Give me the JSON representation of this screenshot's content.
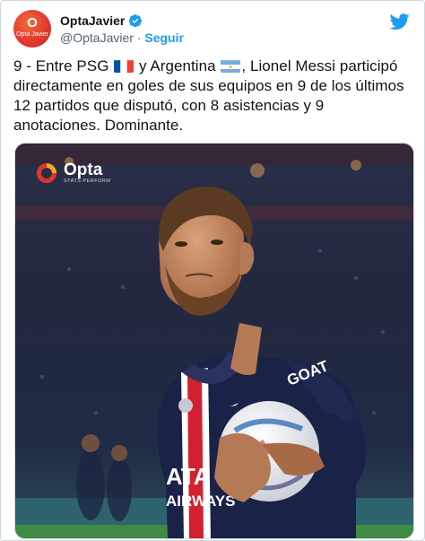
{
  "author": {
    "display_name": "OptaJavier",
    "handle": "@OptaJavier",
    "separator": "·",
    "follow_label": "Seguir",
    "avatar_letter": "O",
    "avatar_caption": "Opta Javier",
    "verified": true
  },
  "tweet": {
    "part1": "9 - Entre PSG",
    "part2": " y Argentina",
    "part3": ", Lionel Messi participó directamente en goles de sus equipos en 9 de los últimos 12 partidos que disputó, con 8 asistencias y 9 anotaciones. Dominante.",
    "flag1": "france-flag",
    "flag2": "argentina-flag"
  },
  "media": {
    "logo_word": "Opta",
    "logo_sub": "STATS PERFORM",
    "shirt_text_1": "ATA",
    "shirt_text_2": "AIRWAYS",
    "sleeve_text": "GOAT",
    "colors": {
      "shirt": "#1b2247",
      "red_stripe": "#d22030",
      "pitch": "#3f8a44",
      "brand_red": "#e1362d",
      "twitter_blue": "#1d9bf0"
    }
  }
}
